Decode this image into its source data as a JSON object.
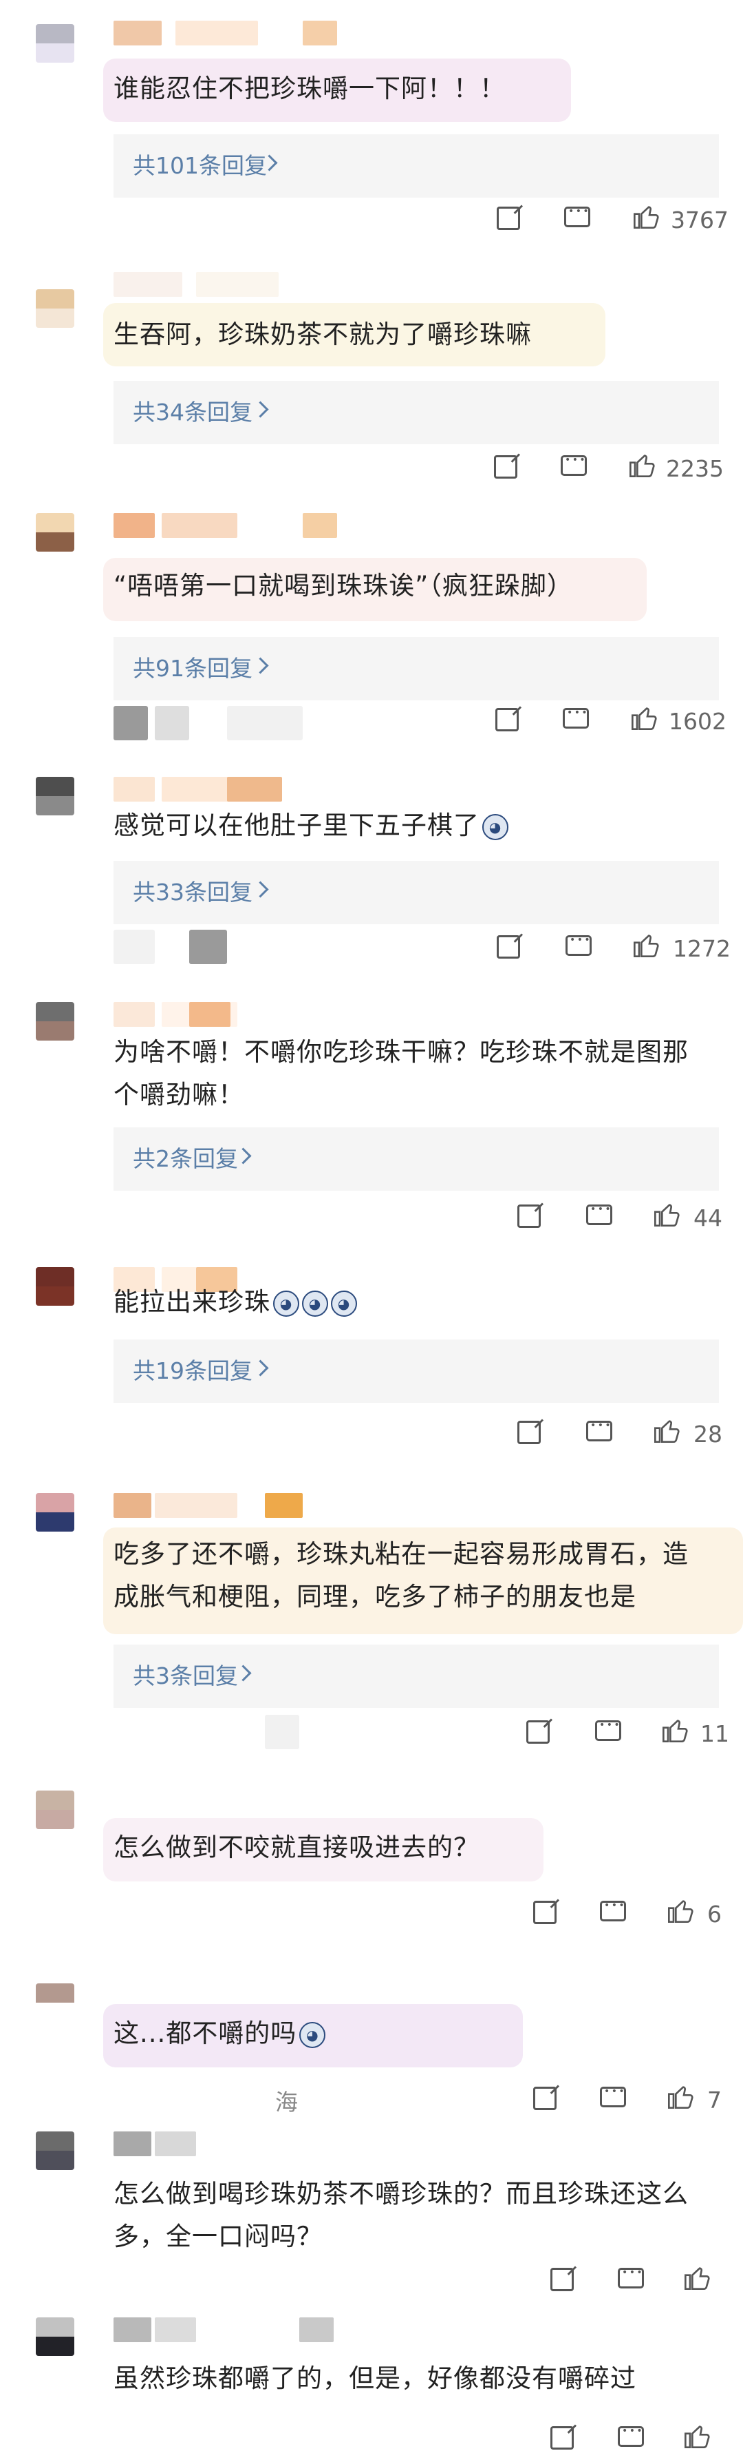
{
  "comments": [
    {
      "text": "谁能忍住不把珍珠嚼一下阿！！！",
      "replies_label": "共101条回复",
      "likes": "3767",
      "avatar_colors": [
        "#b8b8c4",
        "#e7e3f1"
      ],
      "name_colors": [
        "#f0c8a8",
        "#fde9d8",
        "#f5cfa9"
      ],
      "bubble_color": "#f6e9f4"
    },
    {
      "text": "生吞阿，珍珠奶茶不就为了嚼珍珠嘛",
      "replies_label": "共34条回复",
      "likes": "2235",
      "avatar_colors": [
        "#e7c9a1",
        "#f4e6d6"
      ],
      "name_colors": [
        "#f9f1ec",
        "#fbf6ee",
        "#fbf7ef"
      ],
      "bubble_color": "#fbf6e4"
    },
    {
      "text": "“唔唔第一口就喝到珠珠诶”（疯狂跺脚）",
      "replies_label": "共91条回复",
      "likes": "1602",
      "avatar_colors": [
        "#f2d7b1",
        "#8c6047"
      ],
      "name_colors": [
        "#f1b389",
        "#f8d9c1",
        "#f5cfa4"
      ],
      "bubble_color": "#fbf0ee"
    },
    {
      "text": "感觉可以在他肚子里下五子棋了",
      "replies_label": "共33条回复",
      "likes": "1272",
      "avatar_colors": [
        "#4e4e4e",
        "#8a8a8a"
      ],
      "name_colors": [
        "#fbe5d2",
        "#fde8d6",
        "#efb98c"
      ],
      "bubble_color": "#ffffff"
    },
    {
      "text": "为啥不嚼！不嚼你吃珍珠干嘛？吃珍珠不就是图那个嚼劲嘛！",
      "replies_label": "共2条回复",
      "likes": "44",
      "avatar_colors": [
        "#6e6e6e",
        "#9a7b70"
      ],
      "name_colors": [
        "#fbe8d9",
        "#fff3ea",
        "#f3b98a"
      ],
      "bubble_color": "#ffffff"
    },
    {
      "text": "能拉出来珍珠",
      "replies_label": "共19条回复",
      "likes": "28",
      "avatar_colors": [
        "#6e2e26",
        "#7b3327"
      ],
      "name_colors": [
        "#fde8d6",
        "#fff1e4",
        "#f6c79a"
      ],
      "bubble_color": "#ffffff"
    },
    {
      "text": "吃多了还不嚼，珍珠丸粘在一起容易形成胃石，造成胀气和梗阻，同理，吃多了柿子的朋友也是",
      "replies_label": "共3条回复",
      "likes": "11",
      "avatar_colors": [
        "#d9a3a6",
        "#2d3a6e"
      ],
      "name_colors": [
        "#eab48a",
        "#fbe9da",
        "#eea94a"
      ],
      "bubble_color": "#fcf3e4"
    },
    {
      "text": "怎么做到不咬就直接吸进去的？",
      "likes": "6",
      "avatar_colors": [
        "#c8b3a4",
        "#c7aaa3"
      ],
      "name_colors": [
        "#ffffff",
        "#ffffff",
        "#ffffff"
      ],
      "bubble_color": "#f9f0f6"
    },
    {
      "text": "这...都不嚼的吗",
      "likes": "7",
      "location": "海",
      "avatar_colors": [
        "#b3998f",
        "#ffffff"
      ],
      "name_colors": [
        "#ffffff",
        "#ffffff",
        "#ffffff"
      ],
      "bubble_color": "#f3e8f6"
    },
    {
      "text": "怎么做到喝珍珠奶茶不嚼珍珠的？而且珍珠还这么多，全一口闷吗？",
      "avatar_colors": [
        "#6b6b6b",
        "#4f4f5a"
      ],
      "name_colors": [
        "#a9a9a9",
        "#d8d8d8",
        "#ffffff"
      ],
      "bubble_color": "#ffffff"
    },
    {
      "text": "虽然珍珠都嚼了的，但是，好像都没有嚼碎过",
      "avatar_colors": [
        "#c2c2c2",
        "#222228"
      ],
      "name_colors": [
        "#b9b9b9",
        "#dcdcdc",
        "#c9c9c9"
      ],
      "bubble_color": "#ffffff"
    }
  ]
}
